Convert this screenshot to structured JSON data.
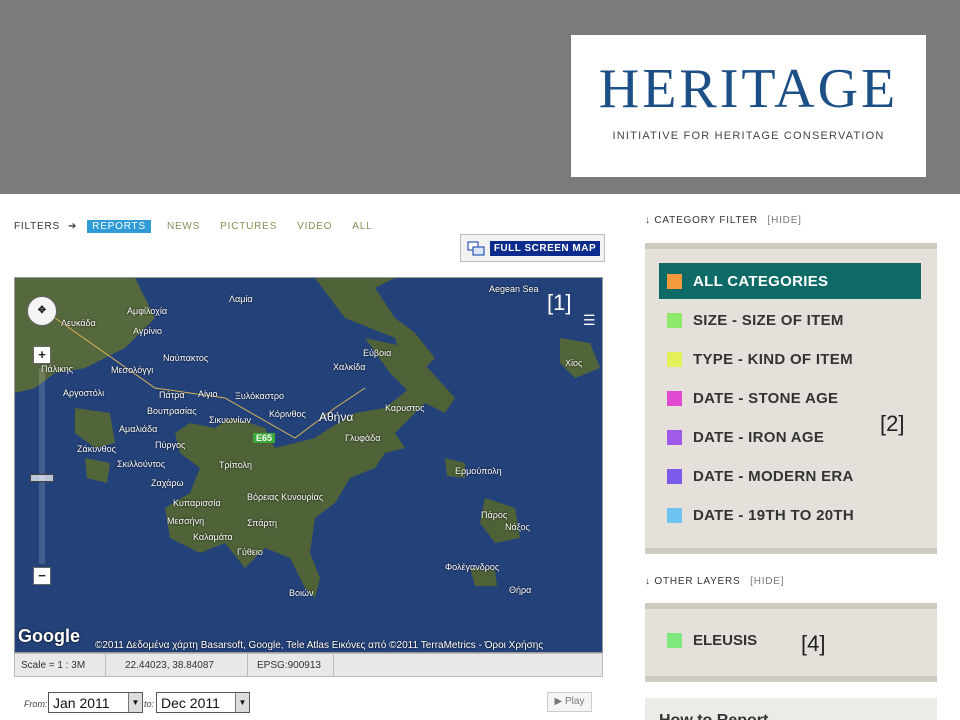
{
  "header": {
    "logo_title": "HERITAGE",
    "logo_subtitle": "INITIATIVE FOR HERITAGE CONSERVATION",
    "background_color": "#7b7b7b",
    "brand_color": "#1b4f86"
  },
  "filters": {
    "label": "FILTERS",
    "tabs": [
      {
        "label": "REPORTS",
        "active": true
      },
      {
        "label": "NEWS",
        "active": false
      },
      {
        "label": "PICTURES",
        "active": false
      },
      {
        "label": "VIDEO",
        "active": false
      },
      {
        "label": "ALL",
        "active": false
      }
    ],
    "fullscreen_label": "FULL SCREEN MAP"
  },
  "map": {
    "annotation": "[1]",
    "google_logo": "Google",
    "copyright": "©2011 Δεδομένα χάρτη Basarsoft, Google, Tele Atlas Εικόνες από ©2011 TerraMetrics - Όροι Χρήσης",
    "road_badge": "E65",
    "places": [
      "Aegean Sea",
      "Λαμία",
      "Αμφίλοχία",
      "Αγρίνιο",
      "Λευκάδα",
      "Ναύπακτος",
      "Μεσολόγγι",
      "Πάλικης",
      "Αργοστόλι",
      "Πάτρα",
      "Αίγιο",
      "Βουπρασίας",
      "Αμαλιάδα",
      "Πύργος",
      "Ζάκυνθος",
      "Σκιλλούντος",
      "Ζαχάρω",
      "Κυπαρισσία",
      "Μεσσήνη",
      "Καλαμάτα",
      "Γύθειο",
      "Τρίπολη",
      "Σπάρτη",
      "Βόρειας Κυνουρίας",
      "Κόρινθος",
      "Σικυωνίων",
      "Ξυλόκαστρο",
      "Αθήνα",
      "Γλυφάδα",
      "Χαλκίδα",
      "Εύβοια",
      "Καρυστος",
      "Ερμούπολη",
      "Νάξος",
      "Πάρος",
      "Φολέγανδρος",
      "Θήρα",
      "Βοιών",
      "Χίος"
    ]
  },
  "statusbar": {
    "scale": "Scale = 1 : 3M",
    "coords": "22.44023, 38.84087",
    "epsg": "EPSG:900913"
  },
  "daterange": {
    "from_label": "From:",
    "to_label": "to:",
    "from_value": "Jan 2011",
    "to_value": "Dec 2011",
    "play_label": "Play"
  },
  "category_filter": {
    "heading": "CATEGORY FILTER",
    "hide_label": "[HIDE]",
    "annotation": "[2]",
    "items": [
      {
        "label": "ALL CATEGORIES",
        "color": "#f59a3c",
        "selected": true
      },
      {
        "label": "SIZE - SIZE OF ITEM",
        "color": "#8ee86a",
        "selected": false
      },
      {
        "label": "TYPE - KIND OF ITEM",
        "color": "#e4f05a",
        "selected": false
      },
      {
        "label": "DATE - STONE AGE",
        "color": "#e04ad0",
        "selected": false
      },
      {
        "label": "DATE - IRON AGE",
        "color": "#a05ae8",
        "selected": false
      },
      {
        "label": "DATE - MODERN ERA",
        "color": "#7a5ae8",
        "selected": false
      },
      {
        "label": "DATE - 19TH TO 20TH",
        "color": "#6ec4f0",
        "selected": false
      }
    ]
  },
  "other_layers": {
    "heading": "OTHER LAYERS",
    "hide_label": "[HIDE]",
    "annotation": "[4]",
    "items": [
      {
        "label": "ELEUSIS",
        "color": "#7ee87e"
      }
    ]
  },
  "howto": {
    "title": "How to Report"
  }
}
